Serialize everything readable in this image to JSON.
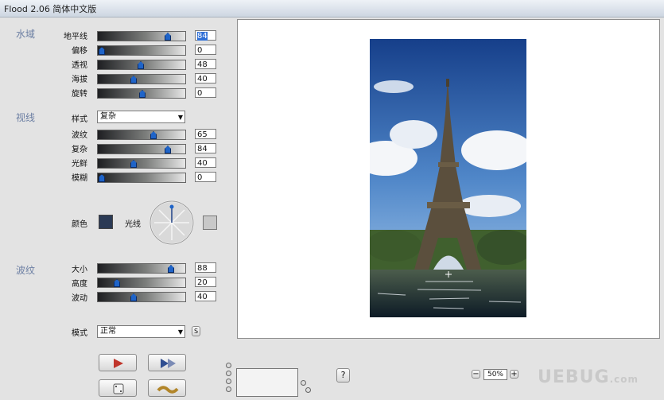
{
  "window": {
    "title": "Flood 2.06 简体中文版"
  },
  "water": {
    "title": "水域",
    "rows": [
      {
        "label": "地平线",
        "value": "84"
      },
      {
        "label": "偏移",
        "value": "0"
      },
      {
        "label": "透视",
        "value": "48"
      },
      {
        "label": "海拔",
        "value": "40"
      },
      {
        "label": "旋转",
        "value": "0"
      }
    ]
  },
  "view": {
    "title": "视线",
    "style_label": "样式",
    "style_value": "复杂",
    "rows": [
      {
        "label": "波纹",
        "value": "65"
      },
      {
        "label": "复杂",
        "value": "84"
      },
      {
        "label": "光鲜",
        "value": "40"
      },
      {
        "label": "模糊",
        "value": "0"
      }
    ],
    "color_label": "颜色",
    "light_label": "光线"
  },
  "ripple": {
    "title": "波纹",
    "rows": [
      {
        "label": "大小",
        "value": "88"
      },
      {
        "label": "高度",
        "value": "20"
      },
      {
        "label": "波动",
        "value": "40"
      }
    ]
  },
  "mode": {
    "label": "模式",
    "value": "正常",
    "extra": "S"
  },
  "help": {
    "label": "?"
  },
  "zoom": {
    "minus": "−",
    "value": "50%",
    "plus": "+"
  },
  "watermark": {
    "text": "UEBUG",
    "suffix": ".com"
  },
  "colors": {
    "water_swatch": "#2b3a55",
    "light_swatch": "#c8c8c8",
    "accent": "#6c7fa3"
  }
}
